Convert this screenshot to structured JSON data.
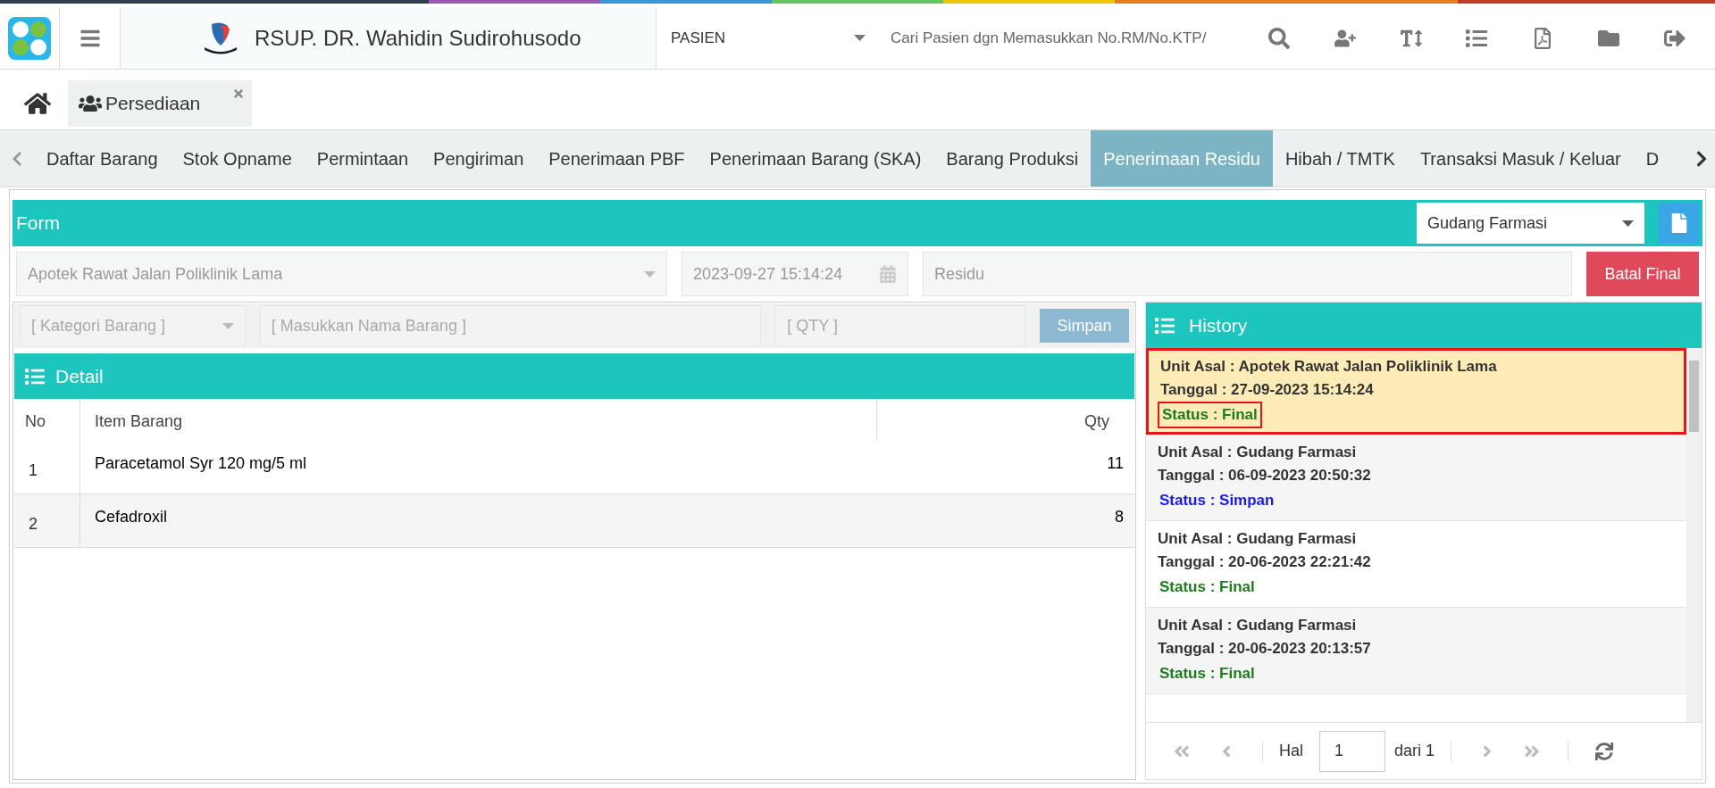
{
  "header": {
    "hospital_name": "RSUP. DR. Wahidin Sudirohusodo",
    "search_type": "PASIEN",
    "search": {
      "placeholder": "Cari Pasien dgn Memasukkan No.RM/No.KTP/"
    }
  },
  "page_tabs": [
    {
      "label": "Persediaan",
      "selected": true
    }
  ],
  "module_tabs": [
    {
      "label": "Daftar Barang",
      "selected": false
    },
    {
      "label": "Stok Opname",
      "selected": false
    },
    {
      "label": "Permintaan",
      "selected": false
    },
    {
      "label": "Pengiriman",
      "selected": false
    },
    {
      "label": "Penerimaan PBF",
      "selected": false
    },
    {
      "label": "Penerimaan Barang (SKA)",
      "selected": false
    },
    {
      "label": "Barang Produksi",
      "selected": false
    },
    {
      "label": "Penerimaan Residu",
      "selected": true
    },
    {
      "label": "Hibah / TMTK",
      "selected": false
    },
    {
      "label": "Transaksi Masuk / Keluar",
      "selected": false
    },
    {
      "label": "D",
      "selected": false
    }
  ],
  "form": {
    "title": "Form",
    "warehouse": "Gudang Farmasi",
    "unit": {
      "value": "Apotek Rawat Jalan Poliklinik Lama",
      "disabled": true
    },
    "date": {
      "value": "2023-09-27 15:14:24",
      "disabled": true
    },
    "type": {
      "value": "Residu",
      "disabled": true
    },
    "final_button": "Batal Final"
  },
  "item_entry": {
    "category": {
      "placeholder": "[ Kategori Barang ]",
      "disabled": true
    },
    "name": {
      "placeholder": "[ Masukkan Nama Barang ]",
      "disabled": true
    },
    "qty": {
      "placeholder": "[ QTY ]",
      "disabled": true
    },
    "save_button": {
      "label": "Simpan",
      "disabled": true
    }
  },
  "detail": {
    "title": "Detail",
    "columns": [
      "No",
      "Item Barang",
      "Qty"
    ],
    "rows": [
      {
        "no": "1",
        "item": "Paracetamol Syr 120 mg/5 ml",
        "qty": "11"
      },
      {
        "no": "2",
        "item": "Cefadroxil",
        "qty": "8"
      }
    ]
  },
  "history": {
    "title": "History",
    "items": [
      {
        "unit": "Unit Asal : Apotek Rawat Jalan Poliklinik Lama",
        "date": "Tanggal : 27-09-2023 15:14:24",
        "status": "Status : Final",
        "color": "#1e7b1e",
        "selected": true
      },
      {
        "unit": "Unit Asal : Gudang Farmasi",
        "date": "Tanggal : 06-09-2023 20:50:32",
        "status": "Status : Simpan",
        "color": "#1a1aee",
        "selected": false
      },
      {
        "unit": "Unit Asal : Gudang Farmasi",
        "date": "Tanggal : 20-06-2023 22:21:42",
        "status": "Status : Final",
        "color": "#1e7b1e",
        "selected": false
      },
      {
        "unit": "Unit Asal : Gudang Farmasi",
        "date": "Tanggal : 20-06-2023 20:13:57",
        "status": "Status : Final",
        "color": "#1e7b1e",
        "selected": false
      }
    ],
    "pager": {
      "page_label": "Hal",
      "page": "1",
      "of_label": "dari 1"
    }
  }
}
